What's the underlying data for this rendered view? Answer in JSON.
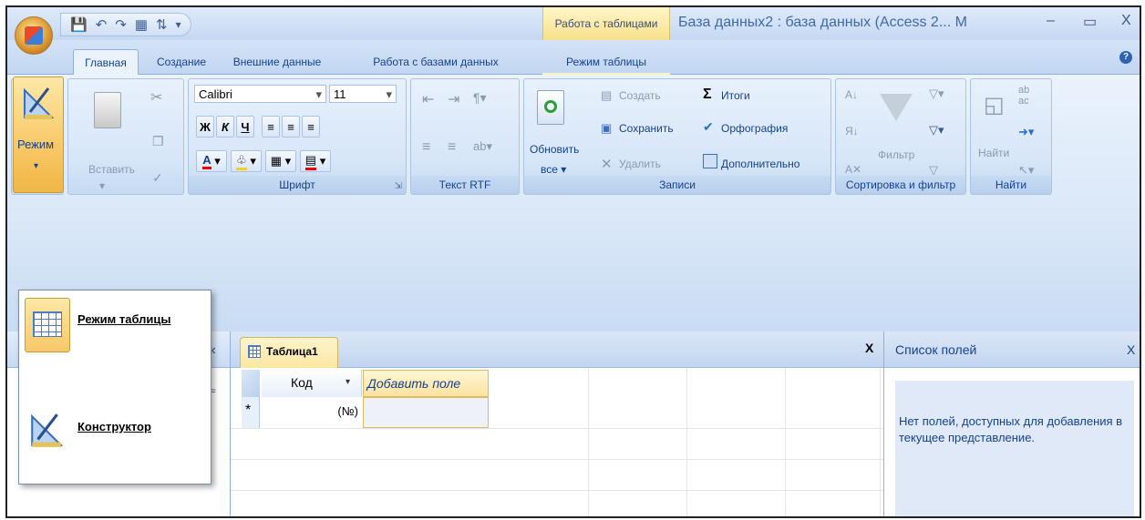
{
  "titlebar": {
    "context_tab": "Работа с таблицами",
    "title": "База данных2 : база данных (Access 2... M",
    "minimize": "–",
    "maximize": "▭",
    "close": "X"
  },
  "tabs": {
    "home": "Главная",
    "create": "Создание",
    "external": "Внешние данные",
    "dbtools": "Работа с базами данных",
    "datasheet": "Режим таблицы"
  },
  "ribbon": {
    "mode": {
      "label": "Режим"
    },
    "clipboard": {
      "paste": "Вставить"
    },
    "font": {
      "name": "Calibri",
      "size": "11",
      "bold": "Ж",
      "italic": "К",
      "underline": "Ч",
      "color_glyph": "A",
      "group_label": "Шрифт"
    },
    "rtf": {
      "group_label": "Текст RTF"
    },
    "records": {
      "refresh": "Обновить",
      "refresh_sub": "все ▾",
      "new": "Создать",
      "save": "Сохранить",
      "delete": "Удалить",
      "totals": "Итоги",
      "spelling": "Орфография",
      "more": "Дополнительно",
      "group_label": "Записи"
    },
    "sort": {
      "filter": "Фильтр",
      "group_label": "Сортировка и фильтр"
    },
    "find": {
      "find": "Найти",
      "group_label": "Найти"
    }
  },
  "dropdown": {
    "items": [
      {
        "label": "Режим таблицы"
      },
      {
        "label": "Конструктор"
      }
    ]
  },
  "doc": {
    "tab_label": "Таблица1",
    "close": "X",
    "col_code": "Код",
    "col_add": "Добавить поле",
    "new_row_marker": "*",
    "new_row_value": "(№)"
  },
  "fieldlist": {
    "title": "Список полей",
    "close": "X",
    "message": "Нет полей, доступных для добавления в текущее представление."
  },
  "nav": {
    "collapse": "«",
    "scroll_up": "≈"
  },
  "colors": {
    "accent_orange": "#f8c867",
    "ribbon_blue": "#dbe8f8",
    "text_blue": "#15428b"
  }
}
